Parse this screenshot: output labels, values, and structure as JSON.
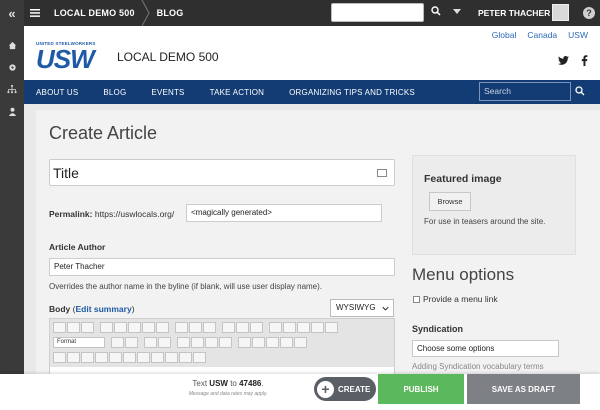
{
  "toolbar": {
    "site_crumb": "LOCAL DEMO 500",
    "section_crumb": "BLOG",
    "user_name": "PETER THACHER",
    "help": "?"
  },
  "header": {
    "logo_small": "UNITED STEELWORKERS",
    "logo_big": "USW",
    "site_name": "LOCAL DEMO 500",
    "top_links": [
      "Global",
      "Canada",
      "USW"
    ]
  },
  "nav": {
    "items": [
      "ABOUT US",
      "BLOG",
      "EVENTS",
      "TAKE ACTION",
      "ORGANIZING TIPS AND TRICKS"
    ],
    "search_placeholder": "Search"
  },
  "form": {
    "page_title": "Create Article",
    "title_placeholder": "Title",
    "permalink_label": "Permalink:",
    "permalink_base": "https://uswlocals.org/",
    "permalink_value": "<magically generated>",
    "author_label": "Article Author",
    "author_value": "Peter Thacher",
    "author_desc": "Overrides the author name in the byline (if blank, will use user display name).",
    "body_label": "Body",
    "body_paren_open": "(",
    "edit_summary": "Edit summary",
    "body_paren_close": ")",
    "editor_mode": "WYSIWYG",
    "format_label": "Format"
  },
  "sidebar": {
    "featured_title": "Featured image",
    "browse_label": "Browse",
    "featured_desc": "For use in teasers around the site.",
    "menu_options_title": "Menu options",
    "menu_link_label": "Provide a menu link",
    "syndication_title": "Syndication",
    "syndication_placeholder": "Choose some options",
    "syndication_note": "Adding Syndication vocabulary terms"
  },
  "bottom": {
    "sms_text": "Text",
    "sms_keyword": "USW",
    "sms_to": "to",
    "sms_number": "47486",
    "sms_end": ".",
    "sms_sub": "Message and data rates may apply.",
    "create_label": "CREATE",
    "publish_label": "PUBLISH",
    "draft_label": "SAVE AS DRAFT"
  },
  "colors": {
    "nav_bg": "#123c73",
    "brand_blue": "#1f5aa6",
    "publish_green": "#5cb85c",
    "draft_gray": "#7d8085",
    "toolbar_dark": "#2f2f2f"
  }
}
